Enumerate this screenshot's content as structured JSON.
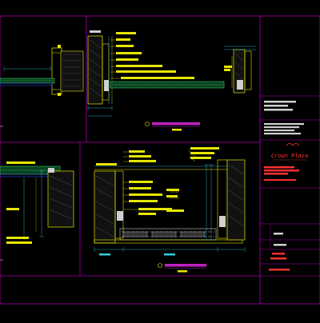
{
  "drawing": {
    "colors": {
      "background": "#000000",
      "frame": "#b000b0",
      "wall": "#e6e600",
      "callout": "#c020c0",
      "dimension": "#30d0e0",
      "finish": "#30d060",
      "accent": "#ff3030"
    },
    "title_block": {
      "logo_text": "Crown Plaza"
    }
  }
}
